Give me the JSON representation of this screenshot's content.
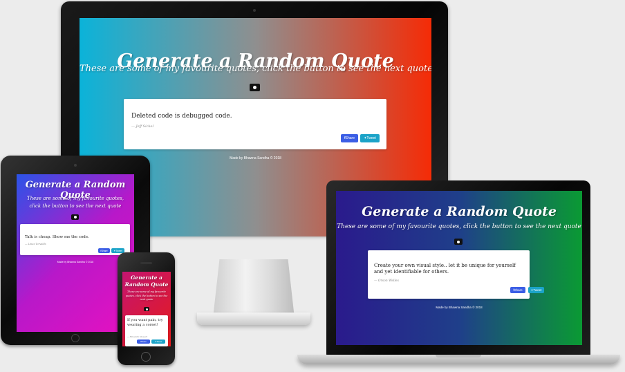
{
  "title": "Generate a Random Quote",
  "subtitle": "These are some of my favourite quotes, click the button to see the next quote",
  "share_label": "Share",
  "tweet_label": "Tweet",
  "footer": "Made by Bhawna Sandha © 2018",
  "devices": {
    "desktop": {
      "quote": "Deleted code is debugged code.",
      "author": "— Jeff Sickel",
      "gradient": [
        "#0bb3d9",
        "#8f8f8f",
        "#f52b06"
      ]
    },
    "tablet": {
      "quote": "Talk is cheap. Show me the code.",
      "author": "— Linus Torvalds",
      "gradient": [
        "#2a54e8",
        "#b818c9",
        "#e711c0"
      ]
    },
    "laptop": {
      "quote": "Create your own visual style.. let it be unique for yourself and yet identifiable for others.",
      "author": "— Orson Welles",
      "gradient": [
        "#2a1a8c",
        "#1f3f8a",
        "#0a9a33"
      ]
    },
    "phone": {
      "quote": "If you want pain, try wearing a corset!",
      "author": "— Elizabeth Stewart",
      "gradient": [
        "#c41570",
        "#e61b1b"
      ]
    }
  }
}
